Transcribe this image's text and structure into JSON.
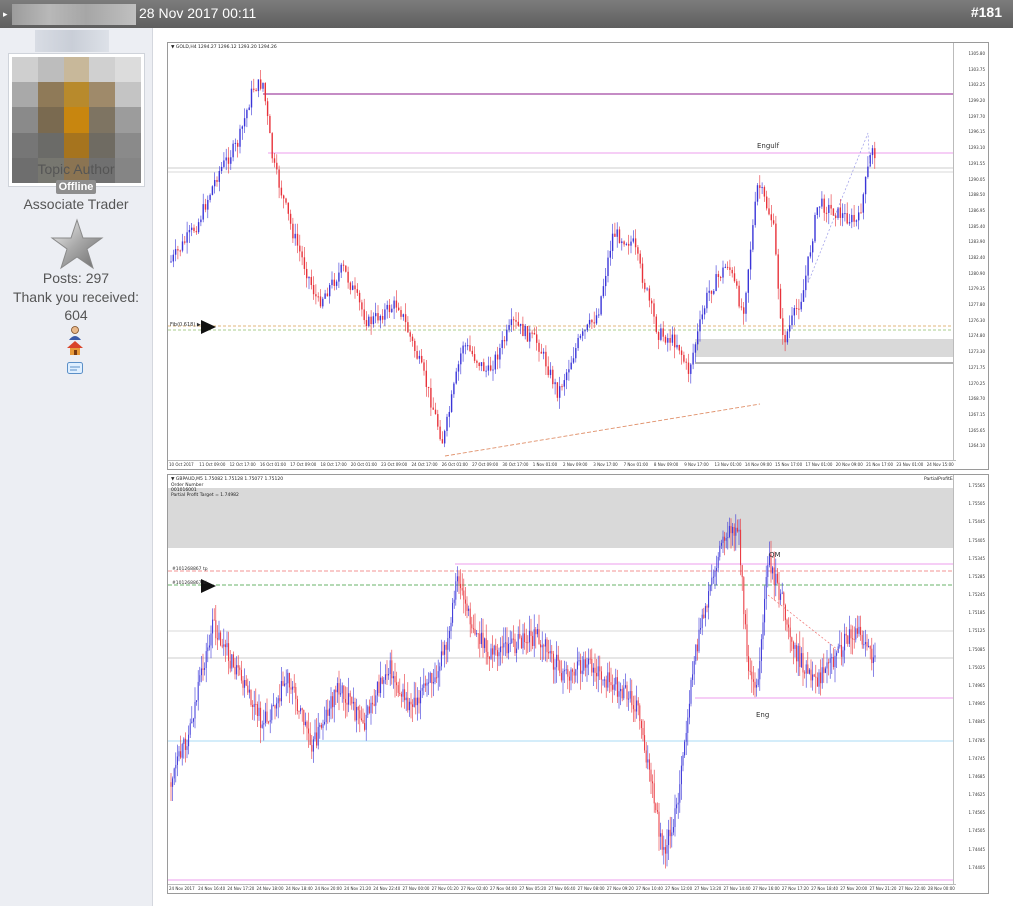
{
  "header": {
    "post_date": "28 Nov 2017 00:11",
    "post_number": "#181"
  },
  "user": {
    "role": "Topic Author",
    "status": "Offline",
    "rank": "Associate Trader",
    "posts": "Posts: 297",
    "thanks_label": "Thank you received:",
    "thanks_count": "604"
  },
  "chart_top": {
    "header_text": "▼ GOLD,H4  1294.27 1296.12 1293.20 1294.26",
    "annotation": "Engulf",
    "line_label": "Fib(0.618) ▶",
    "price_ticks": [
      "1305.80",
      "1303.75",
      "1302.25",
      "1299.20",
      "1297.70",
      "1296.15",
      "1293.10",
      "1291.55",
      "1290.05",
      "1288.50",
      "1286.95",
      "1285.40",
      "1283.90",
      "1282.40",
      "1280.90",
      "1279.35",
      "1277.80",
      "1276.30",
      "1274.80",
      "1273.30",
      "1271.75",
      "1270.25",
      "1268.70",
      "1267.15",
      "1265.65",
      "1264.10"
    ],
    "time_ticks": [
      "10 Oct 2017",
      "11 Oct 09:00",
      "12 Oct 17:00",
      "16 Oct 01:00",
      "17 Oct 09:00",
      "18 Oct 17:00",
      "20 Oct 01:00",
      "23 Oct 09:00",
      "24 Oct 17:00",
      "26 Oct 01:00",
      "27 Oct 09:00",
      "30 Oct 17:00",
      "1 Nov 01:00",
      "2 Nov 09:00",
      "3 Nov 17:00",
      "7 Nov 01:00",
      "8 Nov 09:00",
      "9 Nov 17:00",
      "13 Nov 01:00",
      "14 Nov 09:00",
      "15 Nov 17:00",
      "17 Nov 01:00",
      "20 Nov 09:00",
      "21 Nov 17:00",
      "23 Nov 01:00",
      "24 Nov 15:00"
    ]
  },
  "chart_bottom": {
    "header_text": "▼ GBPAUD,M5  1.75082 1.75128 1.75077 1.75120",
    "header_line2": "Order Number",
    "header_line3": "001016001",
    "header_line4": "Partial Profit Target = 1.74982",
    "right_label": "PartialProfitEA ☺",
    "annotation_qm": "QM",
    "annotation_eng": "Eng",
    "line_label_1": "#101268867 tp",
    "line_label_2": "#101268867 sl",
    "price_ticks": [
      "1.75565",
      "1.75505",
      "1.75445",
      "1.75405",
      "1.75345",
      "1.75285",
      "1.75245",
      "1.75185",
      "1.75125",
      "1.75085",
      "1.75025",
      "1.74965",
      "1.74905",
      "1.74845",
      "1.74785",
      "1.74745",
      "1.74685",
      "1.74625",
      "1.74565",
      "1.74505",
      "1.74445",
      "1.74405"
    ],
    "time_ticks": [
      "24 Nov 2017",
      "24 Nov 16:40",
      "24 Nov 17:20",
      "24 Nov 18:00",
      "24 Nov 18:40",
      "24 Nov 20:00",
      "24 Nov 21:20",
      "24 Nov 22:40",
      "27 Nov 00:00",
      "27 Nov 01:20",
      "27 Nov 02:40",
      "27 Nov 04:00",
      "27 Nov 05:20",
      "27 Nov 06:40",
      "27 Nov 08:00",
      "27 Nov 09:20",
      "27 Nov 10:40",
      "27 Nov 12:00",
      "27 Nov 13:20",
      "27 Nov 14:40",
      "27 Nov 16:00",
      "27 Nov 17:20",
      "27 Nov 18:40",
      "27 Nov 20:00",
      "27 Nov 21:20",
      "27 Nov 22:40",
      "28 Nov 00:00"
    ]
  },
  "colors": {
    "bull": "#3a35d8",
    "bear": "#e8323a",
    "zone": "#d9d9d9",
    "resistance": "#8b1a8b",
    "pink": "#e87ee8"
  }
}
